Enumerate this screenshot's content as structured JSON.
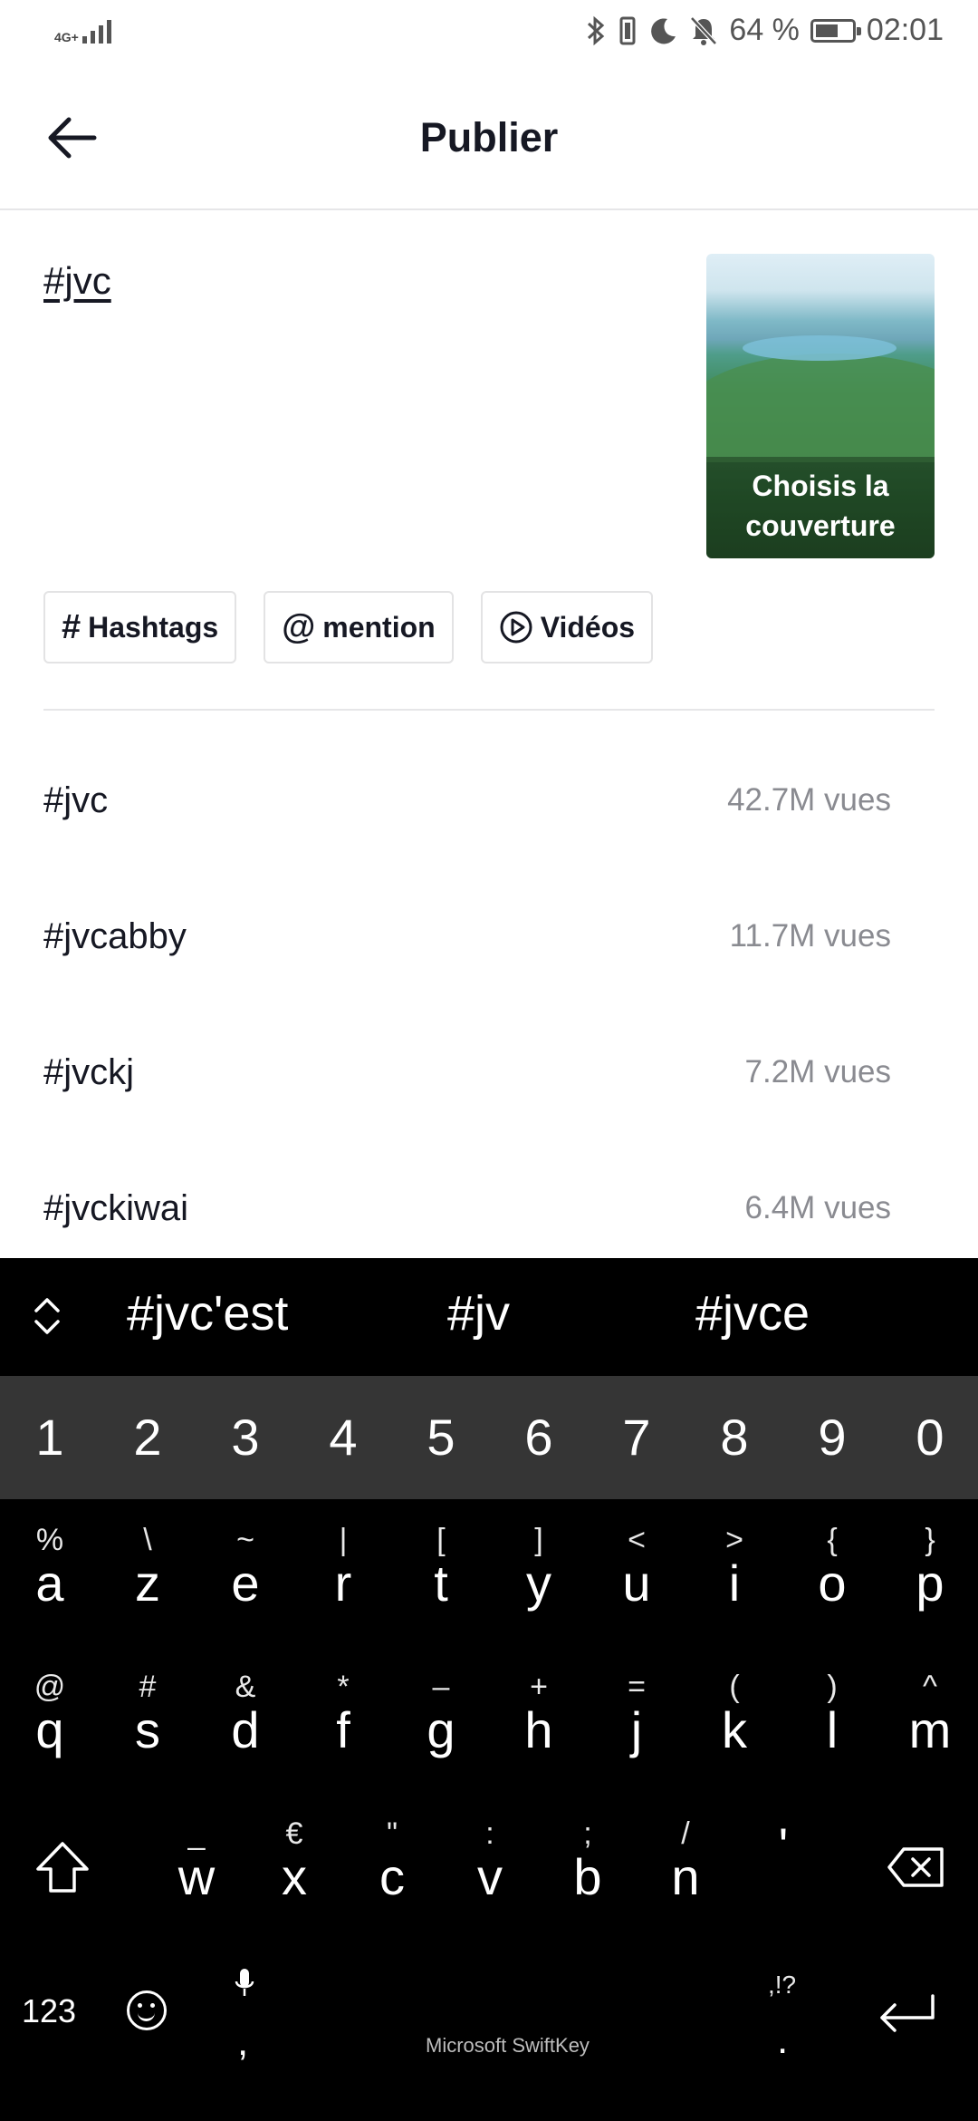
{
  "status_bar": {
    "network": "4G+",
    "battery": "64 %",
    "battery_level": 0.64,
    "time": "02:01",
    "icons": [
      "signal-icon",
      "bluetooth-icon",
      "vibrate-icon",
      "moon-icon",
      "bell-off-icon",
      "battery-icon"
    ]
  },
  "header": {
    "title": "Publier"
  },
  "caption": {
    "text": "#jvc"
  },
  "cover": {
    "label_line1": "Choisis la",
    "label_line2": "couverture"
  },
  "chips": [
    {
      "icon": "#",
      "label": "Hashtags"
    },
    {
      "icon": "@",
      "label": "mention"
    },
    {
      "icon": "play-circle-icon",
      "label": "Vidéos"
    }
  ],
  "suggestions": [
    {
      "tag": "#jvc",
      "views": "42.7M vues"
    },
    {
      "tag": "#jvcabby",
      "views": "11.7M vues"
    },
    {
      "tag": "#jvckj",
      "views": "7.2M vues"
    },
    {
      "tag": "#jvckiwai",
      "views": "6.4M vues"
    }
  ],
  "keyboard": {
    "word_suggestions": [
      "#jvc'est",
      "#jv",
      "#jvce"
    ],
    "numbers": [
      "1",
      "2",
      "3",
      "4",
      "5",
      "6",
      "7",
      "8",
      "9",
      "0"
    ],
    "row1": [
      {
        "sym": "%",
        "ch": "a"
      },
      {
        "sym": "\\",
        "ch": "z"
      },
      {
        "sym": "~",
        "ch": "e"
      },
      {
        "sym": "|",
        "ch": "r"
      },
      {
        "sym": "[",
        "ch": "t"
      },
      {
        "sym": "]",
        "ch": "y"
      },
      {
        "sym": "<",
        "ch": "u"
      },
      {
        "sym": ">",
        "ch": "i"
      },
      {
        "sym": "{",
        "ch": "o"
      },
      {
        "sym": "}",
        "ch": "p"
      }
    ],
    "row2": [
      {
        "sym": "@",
        "ch": "q"
      },
      {
        "sym": "#",
        "ch": "s"
      },
      {
        "sym": "&",
        "ch": "d"
      },
      {
        "sym": "*",
        "ch": "f"
      },
      {
        "sym": "–",
        "ch": "g"
      },
      {
        "sym": "+",
        "ch": "h"
      },
      {
        "sym": "=",
        "ch": "j"
      },
      {
        "sym": "(",
        "ch": "k"
      },
      {
        "sym": ")",
        "ch": "l"
      },
      {
        "sym": "^",
        "ch": "m"
      }
    ],
    "row3": [
      {
        "sym": "_",
        "ch": "w"
      },
      {
        "sym": "€",
        "ch": "x"
      },
      {
        "sym": "\"",
        "ch": "c"
      },
      {
        "sym": ":",
        "ch": "v"
      },
      {
        "sym": ";",
        "ch": "b"
      },
      {
        "sym": "/",
        "ch": "n"
      },
      {
        "sym": "",
        "ch": "'"
      }
    ],
    "key_123": "123",
    "comma": ",",
    "brand": "Microsoft SwiftKey",
    "punct_top": ",!?",
    "dot": "."
  }
}
